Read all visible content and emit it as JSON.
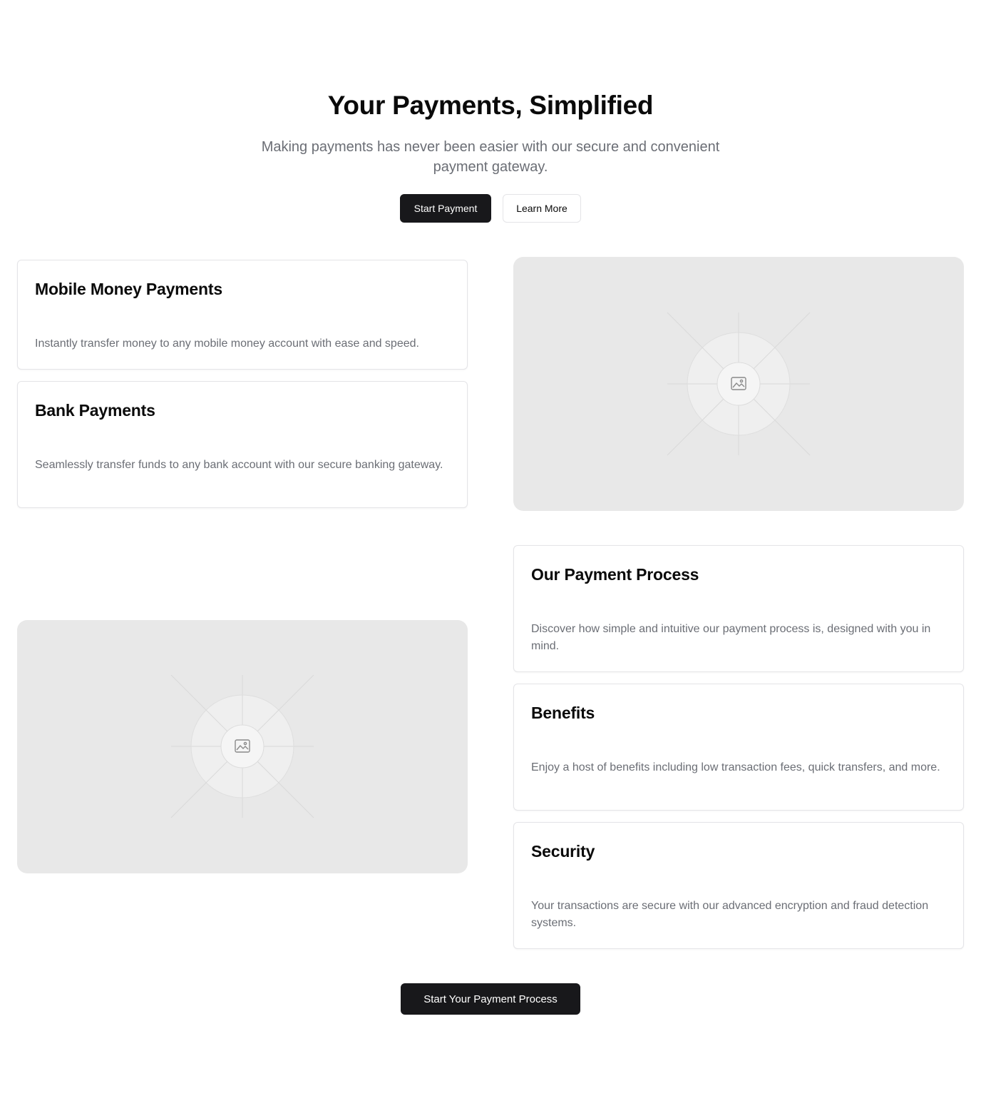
{
  "hero": {
    "title": "Your Payments, Simplified",
    "subtitle": "Making payments has never been easier with our secure and convenient payment gateway.",
    "primary_button": "Start Payment",
    "secondary_button": "Learn More"
  },
  "cards": {
    "mobile_money": {
      "title": "Mobile Money Payments",
      "description": "Instantly transfer money to any mobile money account with ease and speed."
    },
    "bank": {
      "title": "Bank Payments",
      "description": "Seamlessly transfer funds to any bank account with our secure banking gateway."
    },
    "process": {
      "title": "Our Payment Process",
      "description": "Discover how simple and intuitive our payment process is, designed with you in mind."
    },
    "benefits": {
      "title": "Benefits",
      "description": "Enjoy a host of benefits including low transaction fees, quick transfers, and more."
    },
    "security": {
      "title": "Security",
      "description": "Your transactions are secure with our advanced encryption and fraud detection systems."
    }
  },
  "images": {
    "top_right_icon": "image-placeholder-icon",
    "bottom_left_icon": "image-placeholder-icon"
  },
  "cta": {
    "label": "Start Your Payment Process"
  },
  "colors": {
    "primary": "#18181b",
    "muted_text": "#6b6e75",
    "border": "#e4e4e7",
    "placeholder_bg": "#e8e8e8"
  }
}
